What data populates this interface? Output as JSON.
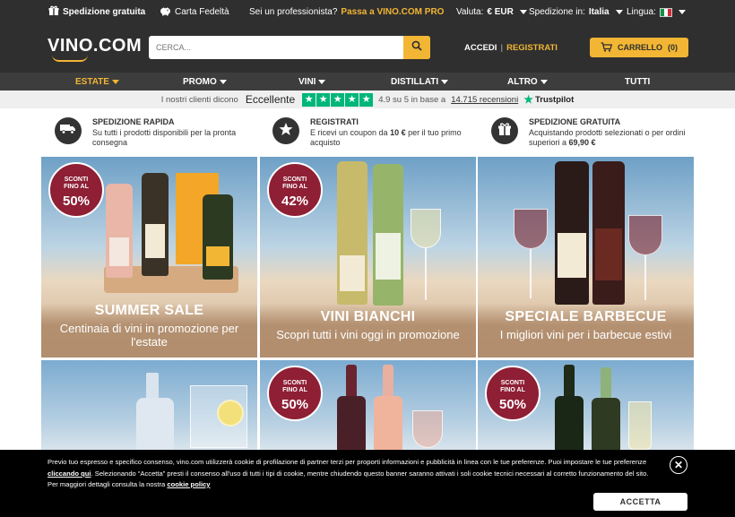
{
  "topbar": {
    "free_shipping": "Spedizione gratuita",
    "loyalty": "Carta Fedeltà",
    "pro_question": "Sei un professionista?",
    "pro_link": "Passa a VINO.COM PRO",
    "currency_label": "Valuta:",
    "currency_value": "€ EUR",
    "shipping_label": "Spedizione in:",
    "shipping_value": "Italia",
    "language_label": "Lingua:"
  },
  "header": {
    "logo": "VINO.COM",
    "search_placeholder": "CERCA...",
    "login": "ACCEDI",
    "separator": "|",
    "register": "REGISTRATI",
    "cart": "CARRELLO",
    "cart_count": "(0)"
  },
  "nav": {
    "items": [
      {
        "label": "ESTATE"
      },
      {
        "label": "PROMO"
      },
      {
        "label": "VINI"
      },
      {
        "label": "DISTILLATI"
      },
      {
        "label": "ALTRO"
      },
      {
        "label": "TUTTI"
      }
    ]
  },
  "trustpilot": {
    "intro": "I nostri clienti dicono",
    "rating_word": "Eccellente",
    "score_text": "4.9 su 5 in base a",
    "reviews": "14.715 recensioni",
    "brand": "Trustpilot"
  },
  "benefits": [
    {
      "title": "SPEDIZIONE RAPIDA",
      "desc": "Su tutti i prodotti disponibili per la pronta consegna",
      "icon": "truck-icon"
    },
    {
      "title": "REGISTRATI",
      "desc_prefix": "E ricevi un coupon da ",
      "desc_bold": "10 €",
      "desc_suffix": " per il tuo primo acquisto",
      "icon": "star-icon"
    },
    {
      "title": "SPEDIZIONE GRATUITA",
      "desc_prefix": "Acquistando prodotti selezionati o per ordini superiori a ",
      "desc_bold": "69,90 €",
      "icon": "gift-icon"
    }
  ],
  "tiles": [
    {
      "badge_line1": "SCONTI",
      "badge_line2": "FINO AL",
      "badge_pct": "50%",
      "title": "SUMMER SALE",
      "subtitle": "Centinaia di vini in promozione per l'estate"
    },
    {
      "badge_line1": "SCONTI",
      "badge_line2": "FINO AL",
      "badge_pct": "42%",
      "title": "VINI BIANCHI",
      "subtitle": "Scopri tutti i vini oggi in promozione"
    },
    {
      "title": "SPECIALE BARBECUE",
      "subtitle": "I migliori vini per i barbecue estivi"
    },
    {},
    {
      "badge_line1": "SCONTI",
      "badge_line2": "FINO AL",
      "badge_pct": "50%"
    },
    {
      "badge_line1": "SCONTI",
      "badge_line2": "FINO AL",
      "badge_pct": "50%"
    }
  ],
  "cookie": {
    "text_1": "Previo tuo espresso e specifico consenso, vino.com utilizzerà cookie di profilazione di partner terzi per proporti informazioni e pubblicità in linea con le tue preferenze. Puoi impostare le tue preferenze ",
    "link_1": "cliccando qui",
    "text_2": ". Selezionando “Accetta” presti il consenso all'uso di tutti i tipi di cookie, mentre chiudendo questo banner saranno attivati i soli cookie tecnici necessari al corretto funzionamento del sito. Per maggiori dettagli consulta la nostra ",
    "link_2": "cookie policy",
    "accept": "ACCETTA"
  },
  "colors": {
    "dark": "#2f2f2f",
    "accent": "#f2b634",
    "badge": "#8e1f35",
    "trustpilot": "#00b67a"
  }
}
